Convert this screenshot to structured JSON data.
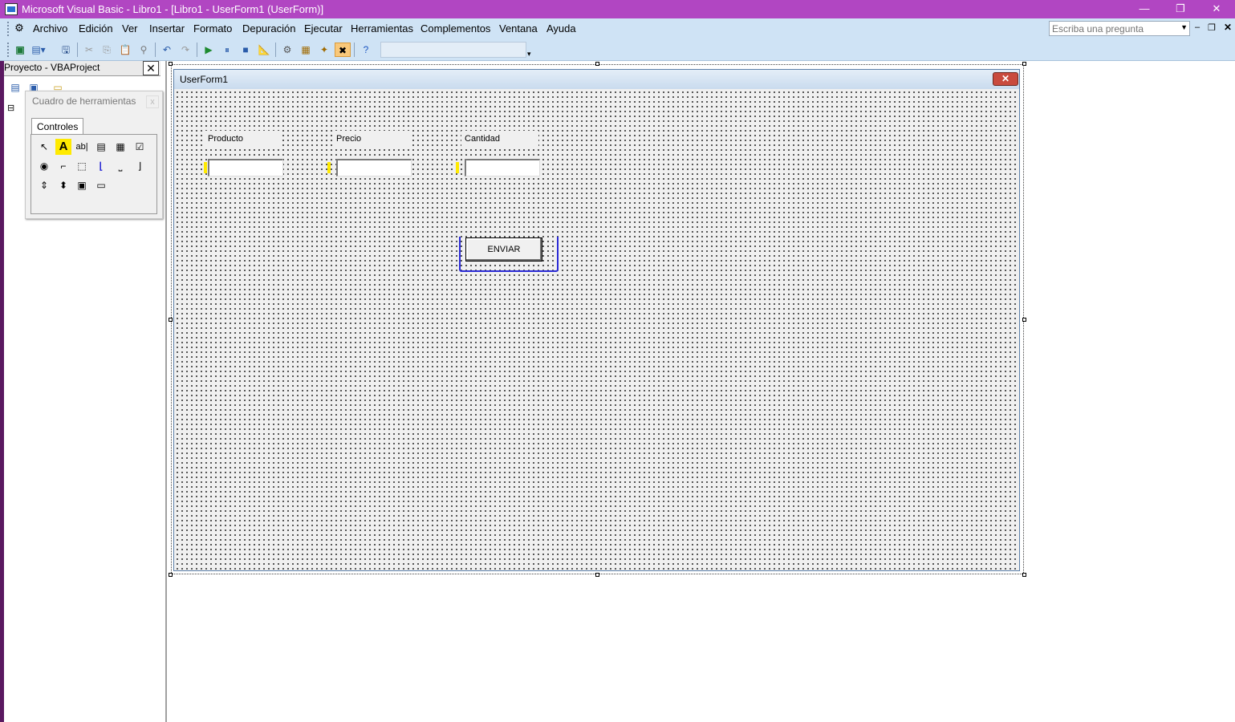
{
  "window": {
    "title": "Microsoft Visual Basic - Libro1 - [Libro1 - UserForm1 (UserForm)]",
    "minimize": "—",
    "restore": "❐",
    "close": "✕"
  },
  "menubar": {
    "items": [
      "Archivo",
      "Edición",
      "Ver",
      "Insertar",
      "Formato",
      "Depuración",
      "Ejecutar",
      "Herramientas",
      "Complementos",
      "Ventana",
      "Ayuda"
    ],
    "ask_placeholder": "Escriba una pregunta",
    "doc_minimize": "–",
    "doc_restore": "❐",
    "doc_close": "✕"
  },
  "toolbar": {
    "icons": [
      "excel-icon",
      "insert-userform-icon",
      "save-icon",
      "cut-icon",
      "copy-icon",
      "paste-icon",
      "find-icon",
      "undo-icon",
      "redo-icon",
      "run-icon",
      "break-icon",
      "reset-icon",
      "design-mode-icon",
      "project-explorer-icon",
      "properties-icon",
      "object-browser-icon",
      "toolbox-icon",
      "help-icon"
    ]
  },
  "project_pane": {
    "title": "Proyecto - VBAProject",
    "close": "✕",
    "tree_toggle": "⊟"
  },
  "toolbox": {
    "title": "Cuadro de herramientas",
    "close": "x",
    "tab": "Controles",
    "tools": [
      {
        "name": "select-objects",
        "glyph": "↖"
      },
      {
        "name": "label",
        "glyph": "A"
      },
      {
        "name": "textbox",
        "glyph": "ab|"
      },
      {
        "name": "combobox",
        "glyph": "▤"
      },
      {
        "name": "listbox",
        "glyph": "▦"
      },
      {
        "name": "checkbox",
        "glyph": "☑"
      },
      {
        "name": "optionbutton",
        "glyph": "◉"
      },
      {
        "name": "togglebutton",
        "glyph": "⌐"
      },
      {
        "name": "frame",
        "glyph": "⬚"
      },
      {
        "name": "commandbutton",
        "glyph": "⌊"
      },
      {
        "name": "tabstrip",
        "glyph": "⎵"
      },
      {
        "name": "multipage",
        "glyph": "⌋"
      },
      {
        "name": "scrollbar",
        "glyph": "⇕"
      },
      {
        "name": "spinbutton",
        "glyph": "⬍"
      },
      {
        "name": "image",
        "glyph": "▣"
      },
      {
        "name": "refedit",
        "glyph": "▭"
      }
    ]
  },
  "form": {
    "title": "UserForm1",
    "close": "✕",
    "labels": [
      "Producto",
      "Precio",
      "Cantidad"
    ],
    "button": "ENVIAR"
  }
}
